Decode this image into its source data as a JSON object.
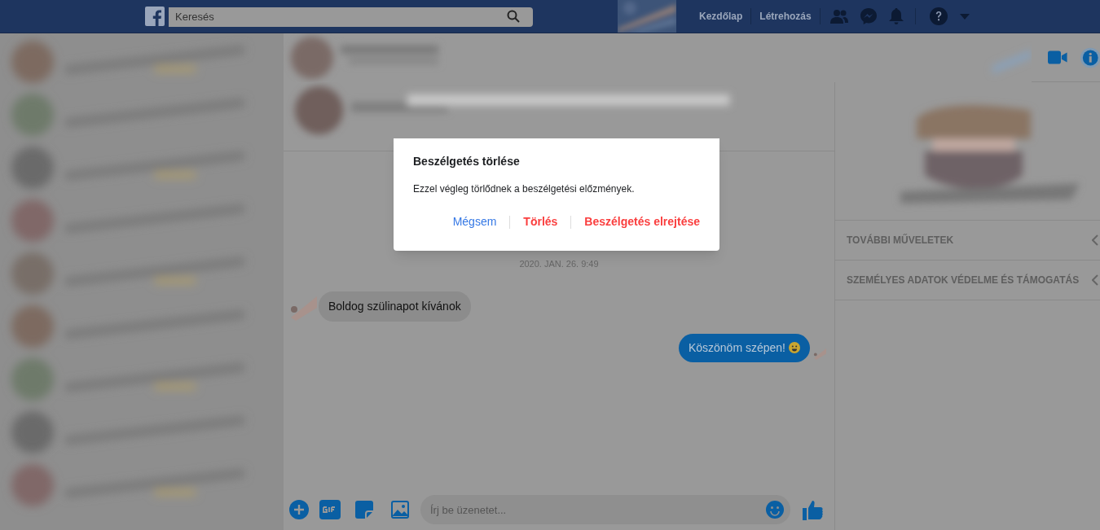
{
  "top_bar": {
    "search": {
      "placeholder": "Keresés"
    },
    "nav_links": [
      "Kezdőlap",
      "Létrehozás"
    ]
  },
  "chat": {
    "timestamp": "2020. JAN. 26. 9:49",
    "messages": [
      {
        "text": "Boldog szülinapot kívánok",
        "kind": "incoming"
      },
      {
        "text": "Köszönöm szépen!",
        "kind": "outgoing"
      }
    ],
    "composer": {
      "placeholder": "Írj be üzenetet..."
    }
  },
  "details_panel": {
    "sections": [
      {
        "label": "TOVÁBBI MŰVELETEK",
        "expanded": false
      },
      {
        "label": "SZEMÉLYES ADATOK VÉDELME ÉS TÁMOGATÁS",
        "expanded": false
      }
    ]
  },
  "dialog": {
    "title": "Beszélgetés törlése",
    "message": "Ezzel végleg törlődnek a beszélgetési előzmények.",
    "buttons": [
      {
        "label": "Mégsem",
        "kind": "cancel"
      },
      {
        "label": "Törlés",
        "kind": "destructive"
      },
      {
        "label": "Beszélgetés elrejtése",
        "kind": "destructive"
      }
    ]
  }
}
